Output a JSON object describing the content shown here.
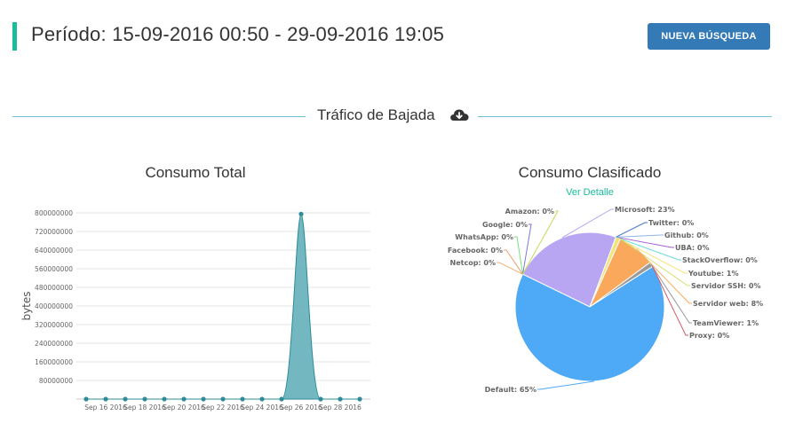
{
  "header": {
    "period": "Período: 15-09-2016 00:50 - 29-09-2016 19:05",
    "new_search_label": "NUEVA BÚSQUEDA"
  },
  "section": {
    "title": "Tráfico de Bajada",
    "icon": "cloud-download-icon"
  },
  "colors": {
    "accent": "#1abc9c",
    "button": "#337ab7",
    "divider": "#6ec3d6",
    "line_fill": "#5aabb6",
    "line_stroke": "#2e8c9a"
  },
  "chart_data": [
    {
      "type": "area",
      "title": "Consumo Total",
      "xlabel": "",
      "ylabel": "bytes",
      "ylim": [
        0,
        800000000
      ],
      "yticks": [
        "80000000",
        "160000000",
        "240000000",
        "320000000",
        "400000000",
        "480000000",
        "560000000",
        "640000000",
        "720000000",
        "800000000"
      ],
      "ytick_values": [
        80000000,
        160000000,
        240000000,
        320000000,
        400000000,
        480000000,
        560000000,
        640000000,
        720000000,
        800000000
      ],
      "xtick_labels": [
        "Sep 16 2016",
        "Sep 18 2016",
        "Sep 20 2016",
        "Sep 22 2016",
        "Sep 24 2016",
        "Sep 26 2016",
        "Sep 28 2016"
      ],
      "x": [
        "Sep 15",
        "Sep 16",
        "Sep 17",
        "Sep 18",
        "Sep 19",
        "Sep 20",
        "Sep 21",
        "Sep 22",
        "Sep 23",
        "Sep 24",
        "Sep 25",
        "Sep 26",
        "Sep 27",
        "Sep 28",
        "Sep 29"
      ],
      "values": [
        0,
        0,
        0,
        0,
        0,
        0,
        0,
        0,
        0,
        0,
        0,
        795000000,
        0,
        0,
        0
      ],
      "grid": true
    },
    {
      "type": "pie",
      "title": "Consumo Clasificado",
      "detail_link": "Ver Detalle",
      "slices": [
        {
          "label": "Microsoft: 23%",
          "value": 23,
          "color": "#b8a6f2"
        },
        {
          "label": "Twitter: 0%",
          "value": 0,
          "color": "#3b6fd0"
        },
        {
          "label": "Github: 0%",
          "value": 0,
          "color": "#8fb3e8"
        },
        {
          "label": "UBA: 0%",
          "value": 0,
          "color": "#a45fd8"
        },
        {
          "label": "StackOverflow: 0%",
          "value": 0,
          "color": "#5fd6d6"
        },
        {
          "label": "Youtube: 1%",
          "value": 1,
          "color": "#f3e37a"
        },
        {
          "label": "Servidor SSH: 0%",
          "value": 0,
          "color": "#d8e070"
        },
        {
          "label": "Servidor web: 8%",
          "value": 8,
          "color": "#f9a85c"
        },
        {
          "label": "TeamViewer: 1%",
          "value": 1,
          "color": "#9a9a9a"
        },
        {
          "label": "Proxy: 0%",
          "value": 0,
          "color": "#d65a6a"
        },
        {
          "label": "Default: 65%",
          "value": 65,
          "color": "#4ea9f7"
        },
        {
          "label": "Netcop: 0%",
          "value": 0,
          "color": "#f2b27a"
        },
        {
          "label": "Facebook: 0%",
          "value": 0,
          "color": "#f0a070"
        },
        {
          "label": "WhatsApp: 0%",
          "value": 0,
          "color": "#7be07a"
        },
        {
          "label": "Google: 0%",
          "value": 0,
          "color": "#7a7ad8"
        },
        {
          "label": "Amazon: 0%",
          "value": 0,
          "color": "#c8d85a"
        }
      ]
    }
  ]
}
